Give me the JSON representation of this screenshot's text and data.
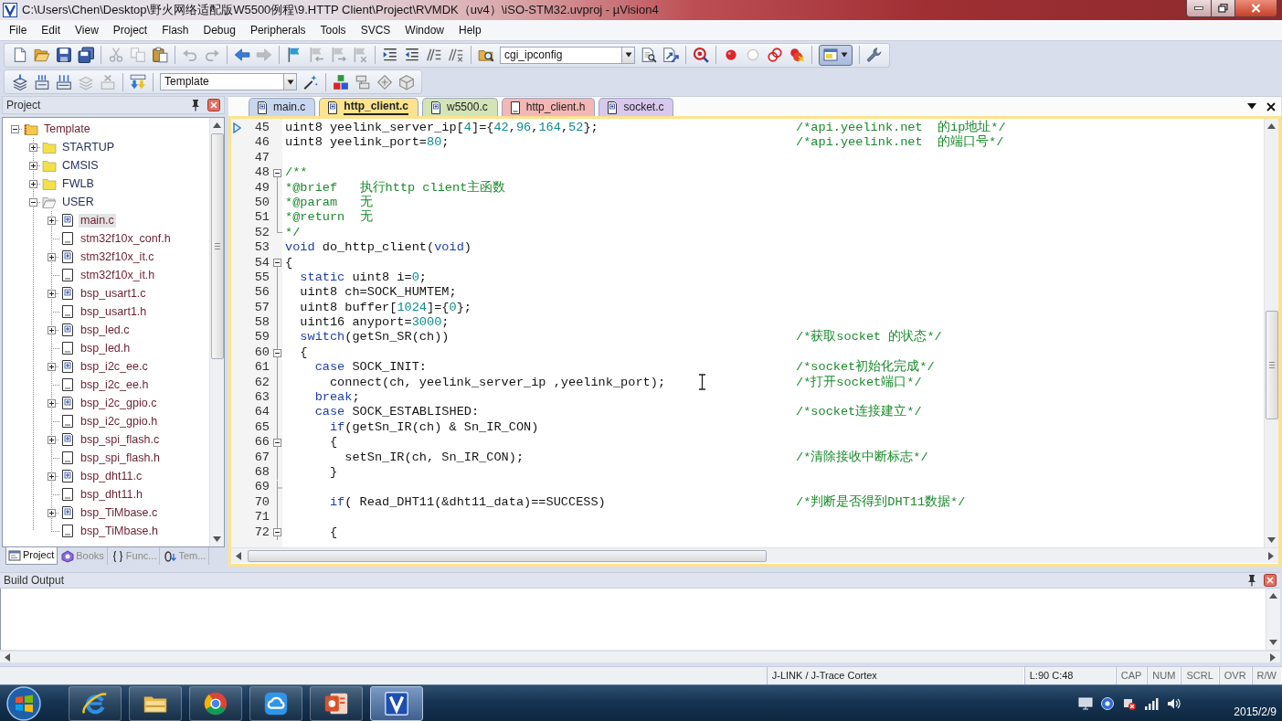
{
  "window": {
    "title": "C:\\Users\\Chen\\Desktop\\野火网络适配版W5500例程\\9.HTTP Client\\Project\\RVMDK（uv4）\\iSO-STM32.uvproj - µVision4"
  },
  "menu": [
    "File",
    "Edit",
    "View",
    "Project",
    "Flash",
    "Debug",
    "Peripherals",
    "Tools",
    "SVCS",
    "Window",
    "Help"
  ],
  "toolbar_1": [
    [
      {
        "kind": "new",
        "disabled": false
      },
      {
        "kind": "open",
        "disabled": false
      },
      {
        "kind": "save",
        "disabled": false
      },
      {
        "kind": "save_all",
        "disabled": false
      }
    ],
    [
      {
        "kind": "cut",
        "disabled": true
      },
      {
        "kind": "copy",
        "disabled": true
      },
      {
        "kind": "paste",
        "disabled": false
      }
    ],
    [
      {
        "kind": "undo",
        "disabled": true
      },
      {
        "kind": "redo",
        "disabled": true
      }
    ],
    [
      {
        "kind": "back",
        "disabled": false
      },
      {
        "kind": "forward",
        "disabled": true
      }
    ],
    [
      {
        "kind": "bookmark",
        "disabled": false
      },
      {
        "kind": "bookmark_prev",
        "disabled": true
      },
      {
        "kind": "bookmark_next",
        "disabled": true
      },
      {
        "kind": "bookmark_clear",
        "disabled": true
      }
    ],
    [
      {
        "kind": "indent",
        "disabled": false
      },
      {
        "kind": "unindent",
        "disabled": false
      },
      {
        "kind": "comment",
        "disabled": false
      },
      {
        "kind": "uncomment",
        "disabled": false
      }
    ],
    [
      {
        "kind": "find_in_files",
        "disabled": false
      },
      {
        "kind": "find_combo",
        "value": "cgi_ipconfig",
        "disabled": false
      },
      {
        "kind": "find",
        "disabled": false
      },
      {
        "kind": "find_incremental",
        "disabled": false
      }
    ],
    [
      {
        "kind": "debug",
        "disabled": false
      }
    ],
    [
      {
        "kind": "breakpoint",
        "disabled": false
      },
      {
        "kind": "breakpoint_toggle",
        "disabled": false
      },
      {
        "kind": "breakpoints_disable",
        "disabled": false
      },
      {
        "kind": "breakpoints_kill",
        "disabled": false
      }
    ],
    [
      {
        "kind": "windows",
        "disabled": false
      }
    ],
    [
      {
        "kind": "config",
        "disabled": false
      }
    ]
  ],
  "toolbar_2": [
    [
      {
        "kind": "translate",
        "disabled": false
      },
      {
        "kind": "build",
        "disabled": false
      },
      {
        "kind": "rebuild",
        "disabled": false
      },
      {
        "kind": "batch_build",
        "disabled": true
      },
      {
        "kind": "stop_build",
        "disabled": true
      }
    ],
    [
      {
        "kind": "download",
        "disabled": false
      }
    ],
    [
      {
        "kind": "target_combo",
        "value": "Template",
        "disabled": false
      },
      {
        "kind": "options",
        "disabled": false
      }
    ],
    [
      {
        "kind": "components",
        "disabled": false
      },
      {
        "kind": "packs",
        "disabled": false
      },
      {
        "kind": "multiproject",
        "disabled": false
      },
      {
        "kind": "pack_installer",
        "disabled": false
      }
    ]
  ],
  "project_pane": {
    "title": "Project",
    "tree": [
      {
        "label": "Template",
        "kind": "project",
        "expanded": true,
        "selected": false,
        "children": [
          {
            "label": "STARTUP",
            "kind": "folder",
            "expanded": false,
            "selected": false
          },
          {
            "label": "CMSIS",
            "kind": "folder",
            "expanded": false,
            "selected": false
          },
          {
            "label": "FWLB",
            "kind": "folder",
            "expanded": false,
            "selected": false
          },
          {
            "label": "USER",
            "kind": "folder",
            "expanded": true,
            "selected": false,
            "children": [
              {
                "label": "main.c",
                "kind": "source",
                "expanded": false,
                "selected": true
              },
              {
                "label": "stm32f10x_conf.h",
                "kind": "header",
                "expanded": false,
                "selected": false
              },
              {
                "label": "stm32f10x_it.c",
                "kind": "source",
                "expanded": false,
                "selected": false
              },
              {
                "label": "stm32f10x_it.h",
                "kind": "header",
                "expanded": false,
                "selected": false
              },
              {
                "label": "bsp_usart1.c",
                "kind": "source",
                "expanded": false,
                "selected": false
              },
              {
                "label": "bsp_usart1.h",
                "kind": "header",
                "expanded": false,
                "selected": false
              },
              {
                "label": "bsp_led.c",
                "kind": "source",
                "expanded": false,
                "selected": false
              },
              {
                "label": "bsp_led.h",
                "kind": "header",
                "expanded": false,
                "selected": false
              },
              {
                "label": "bsp_i2c_ee.c",
                "kind": "source",
                "expanded": false,
                "selected": false
              },
              {
                "label": "bsp_i2c_ee.h",
                "kind": "header",
                "expanded": false,
                "selected": false
              },
              {
                "label": "bsp_i2c_gpio.c",
                "kind": "source",
                "expanded": false,
                "selected": false
              },
              {
                "label": "bsp_i2c_gpio.h",
                "kind": "header",
                "expanded": false,
                "selected": false
              },
              {
                "label": "bsp_spi_flash.c",
                "kind": "source",
                "expanded": false,
                "selected": false
              },
              {
                "label": "bsp_spi_flash.h",
                "kind": "header",
                "expanded": false,
                "selected": false
              },
              {
                "label": "bsp_dht11.c",
                "kind": "source",
                "expanded": false,
                "selected": false
              },
              {
                "label": "bsp_dht11.h",
                "kind": "header",
                "expanded": false,
                "selected": false
              },
              {
                "label": "bsp_TiMbase.c",
                "kind": "source",
                "expanded": false,
                "selected": false
              },
              {
                "label": "bsp_TiMbase.h",
                "kind": "header",
                "expanded": false,
                "selected": false
              }
            ]
          }
        ]
      }
    ],
    "tabs": [
      {
        "label": "Project",
        "kind": "project",
        "selected": true
      },
      {
        "label": "Books",
        "kind": "books",
        "selected": false
      },
      {
        "label": "Func...",
        "kind": "functions",
        "selected": false
      },
      {
        "label": "Tem...",
        "kind": "templates",
        "selected": false
      }
    ]
  },
  "editor": {
    "tabs": [
      {
        "label": "main.c",
        "kind": "source",
        "color": "#c8d7ef",
        "selected": false
      },
      {
        "label": "http_client.c",
        "kind": "source",
        "color": "#fde38e",
        "selected": true
      },
      {
        "label": "w5500.c",
        "kind": "source",
        "color": "#d3e4b6",
        "selected": false
      },
      {
        "label": "http_client.h",
        "kind": "header",
        "color": "#f4b7b5",
        "selected": false
      },
      {
        "label": "socket.c",
        "kind": "source",
        "color": "#d8c8ee",
        "selected": false
      }
    ],
    "lines": [
      {
        "number": "45",
        "kind": "plain",
        "current": true,
        "code": [
          {
            "text": "uint8 yeelink_server_ip[",
            "kind": "plain"
          },
          {
            "text": "4",
            "kind": "number"
          },
          {
            "text": "]={",
            "kind": "plain"
          },
          {
            "text": "42",
            "kind": "number"
          },
          {
            "text": ",",
            "kind": "plain"
          },
          {
            "text": "96",
            "kind": "number"
          },
          {
            "text": ",",
            "kind": "plain"
          },
          {
            "text": "164",
            "kind": "number"
          },
          {
            "text": ",",
            "kind": "plain"
          },
          {
            "text": "52",
            "kind": "number"
          },
          {
            "text": "};",
            "kind": "plain"
          }
        ],
        "comment": "/*api.yeelink.net  的ip地址*/"
      },
      {
        "number": "46",
        "kind": "plain",
        "current": false,
        "code": [
          {
            "text": "uint8 yeelink_port=",
            "kind": "plain"
          },
          {
            "text": "80",
            "kind": "number"
          },
          {
            "text": ";",
            "kind": "plain"
          }
        ],
        "comment": "/*api.yeelink.net  的端口号*/"
      },
      {
        "number": "47",
        "kind": "plain",
        "current": false
      },
      {
        "number": "48",
        "kind": "opener",
        "current": false,
        "code": [
          {
            "text": "/**",
            "kind": "comment"
          }
        ]
      },
      {
        "number": "49",
        "kind": "plain",
        "current": false,
        "code": [
          {
            "text": "*@brief   执行http client主函数",
            "kind": "comment"
          }
        ]
      },
      {
        "number": "50",
        "kind": "plain",
        "current": false,
        "code": [
          {
            "text": "*@param   无",
            "kind": "comment"
          }
        ]
      },
      {
        "number": "51",
        "kind": "plain",
        "current": false,
        "code": [
          {
            "text": "*@return  无",
            "kind": "comment"
          }
        ]
      },
      {
        "number": "52",
        "kind": "closer",
        "current": false,
        "code": [
          {
            "text": "*/",
            "kind": "comment"
          }
        ]
      },
      {
        "number": "53",
        "kind": "plain",
        "current": false,
        "code": [
          {
            "text": "void",
            "kind": "keyword"
          },
          {
            "text": " do_http_client(",
            "kind": "plain"
          },
          {
            "text": "void",
            "kind": "keyword"
          },
          {
            "text": ")",
            "kind": "plain"
          }
        ]
      },
      {
        "number": "54",
        "kind": "opener",
        "current": false,
        "code": [
          {
            "text": "{",
            "kind": "plain"
          }
        ]
      },
      {
        "number": "55",
        "kind": "plain",
        "current": false,
        "code": [
          {
            "text": "  static",
            "kind": "keyword"
          },
          {
            "text": " uint8 i=",
            "kind": "plain"
          },
          {
            "text": "0",
            "kind": "number"
          },
          {
            "text": ";",
            "kind": "plain"
          }
        ]
      },
      {
        "number": "56",
        "kind": "plain",
        "current": false,
        "code": [
          {
            "text": "  uint8 ch=SOCK_HUMTEM;",
            "kind": "plain"
          }
        ]
      },
      {
        "number": "57",
        "kind": "plain",
        "current": false,
        "code": [
          {
            "text": "  uint8 buffer[",
            "kind": "plain"
          },
          {
            "text": "1024",
            "kind": "number"
          },
          {
            "text": "]={",
            "kind": "plain"
          },
          {
            "text": "0",
            "kind": "number"
          },
          {
            "text": "};",
            "kind": "plain"
          }
        ]
      },
      {
        "number": "58",
        "kind": "plain",
        "current": false,
        "code": [
          {
            "text": "  uint16 anyport=",
            "kind": "plain"
          },
          {
            "text": "3000",
            "kind": "number"
          },
          {
            "text": ";",
            "kind": "plain"
          }
        ]
      },
      {
        "number": "59",
        "kind": "plain",
        "current": false,
        "code": [
          {
            "text": "  switch",
            "kind": "keyword"
          },
          {
            "text": "(getSn_SR(ch))",
            "kind": "plain"
          }
        ],
        "comment": "/*获取socket 的状态*/"
      },
      {
        "number": "60",
        "kind": "opener",
        "current": false,
        "code": [
          {
            "text": "  {",
            "kind": "plain"
          }
        ]
      },
      {
        "number": "61",
        "kind": "plain",
        "current": false,
        "code": [
          {
            "text": "    case",
            "kind": "keyword"
          },
          {
            "text": " SOCK_INIT:",
            "kind": "plain"
          }
        ],
        "comment": "/*socket初始化完成*/"
      },
      {
        "number": "62",
        "kind": "plain",
        "current": false,
        "code": [
          {
            "text": "      connect(ch, yeelink_server_ip ,yeelink_port);",
            "kind": "plain"
          }
        ],
        "comment": "/*打开socket端口*/"
      },
      {
        "number": "63",
        "kind": "plain",
        "current": false,
        "code": [
          {
            "text": "    break",
            "kind": "keyword"
          },
          {
            "text": ";",
            "kind": "plain"
          }
        ]
      },
      {
        "number": "64",
        "kind": "plain",
        "current": false,
        "code": [
          {
            "text": "    case",
            "kind": "keyword"
          },
          {
            "text": " SOCK_ESTABLISHED:",
            "kind": "plain"
          }
        ],
        "comment": "/*socket连接建立*/"
      },
      {
        "number": "65",
        "kind": "plain",
        "current": false,
        "code": [
          {
            "text": "      if",
            "kind": "keyword"
          },
          {
            "text": "(getSn_IR(ch) & Sn_IR_CON)",
            "kind": "plain"
          }
        ]
      },
      {
        "number": "66",
        "kind": "opener",
        "current": false,
        "code": [
          {
            "text": "      {",
            "kind": "plain"
          }
        ]
      },
      {
        "number": "67",
        "kind": "plain",
        "current": false,
        "code": [
          {
            "text": "        setSn_IR(ch, Sn_IR_CON);",
            "kind": "plain"
          }
        ],
        "comment": "/*清除接收中断标志*/"
      },
      {
        "number": "68",
        "kind": "plain",
        "current": false,
        "code": [
          {
            "text": "      }",
            "kind": "plain"
          }
        ]
      },
      {
        "number": "69",
        "kind": "closer",
        "current": false
      },
      {
        "number": "70",
        "kind": "plain",
        "current": false,
        "code": [
          {
            "text": "      if",
            "kind": "keyword"
          },
          {
            "text": "( Read_DHT11(&dht11_data)==SUCCESS)",
            "kind": "plain"
          }
        ],
        "comment": "/*判断是否得到DHT11数据*/"
      },
      {
        "number": "71",
        "kind": "plain",
        "current": false
      },
      {
        "number": "72",
        "kind": "opener",
        "current": false,
        "code": [
          {
            "text": "      {",
            "kind": "plain"
          }
        ]
      }
    ]
  },
  "build_output": {
    "title": "Build Output"
  },
  "status_bar": {
    "debugger": "J-LINK / J-Trace Cortex",
    "position": "L:90 C:48",
    "indicators": [
      "CAP",
      "NUM",
      "SCRL",
      "OVR",
      "R/W"
    ]
  },
  "taskbar": {
    "apps": [
      {
        "kind": "browser",
        "selected": false
      },
      {
        "kind": "files",
        "selected": false
      },
      {
        "kind": "web",
        "selected": false
      },
      {
        "kind": "cloud",
        "selected": false
      },
      {
        "kind": "slides",
        "selected": false
      },
      {
        "kind": "ide",
        "selected": true
      }
    ],
    "date": "2015/2/9"
  }
}
